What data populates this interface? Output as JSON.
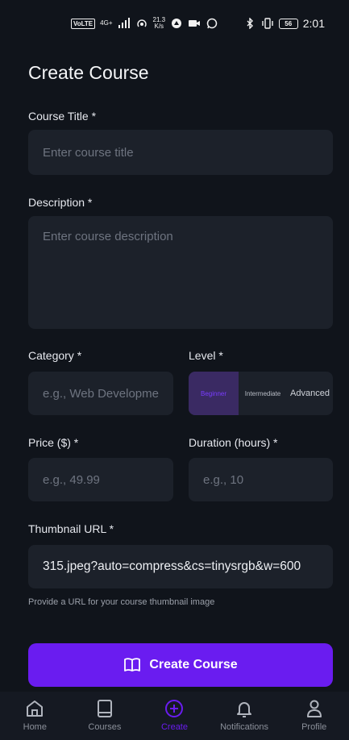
{
  "status_bar": {
    "volte": "VoLTE",
    "network": "4G+",
    "speed_value": "21.3",
    "speed_unit": "K/s",
    "battery": "56",
    "time": "2:01"
  },
  "page": {
    "title": "Create Course"
  },
  "form": {
    "title_label": "Course Title *",
    "title_placeholder": "Enter course title",
    "description_label": "Description *",
    "description_placeholder": "Enter course description",
    "category_label": "Category *",
    "category_placeholder": "e.g., Web Development",
    "level_label": "Level *",
    "levels": [
      "Beginner",
      "Intermediate",
      "Advanced"
    ],
    "level_selected": "Beginner",
    "price_label": "Price ($) *",
    "price_placeholder": "e.g., 49.99",
    "duration_label": "Duration (hours) *",
    "duration_placeholder": "e.g., 10",
    "thumbnail_label": "Thumbnail URL *",
    "thumbnail_value": "315.jpeg?auto=compress&cs=tinysrgb&w=600",
    "thumbnail_helper": "Provide a URL for your course thumbnail image",
    "submit_label": "Create Course"
  },
  "nav": {
    "items": [
      {
        "label": "Home",
        "icon": "home-icon"
      },
      {
        "label": "Courses",
        "icon": "book-icon"
      },
      {
        "label": "Create",
        "icon": "plus-circle-icon"
      },
      {
        "label": "Notifications",
        "icon": "bell-icon"
      },
      {
        "label": "Profile",
        "icon": "user-icon"
      }
    ],
    "active": "Create"
  },
  "colors": {
    "accent": "#6a1cf0",
    "background": "#10141b",
    "input_bg": "#1c212a"
  }
}
